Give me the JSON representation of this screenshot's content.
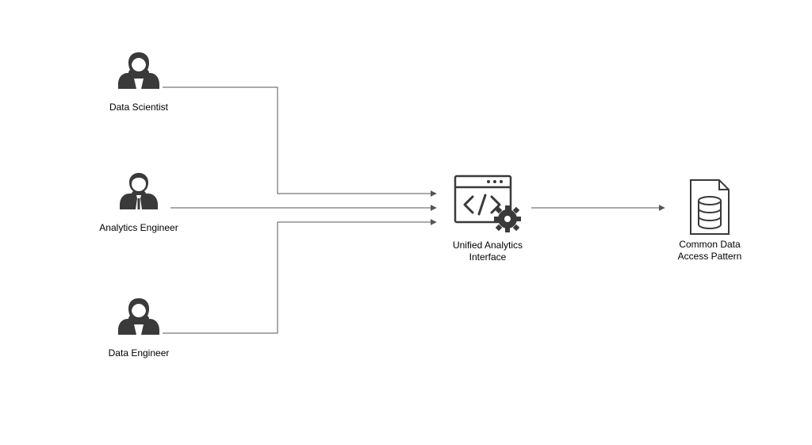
{
  "roles": {
    "data_scientist": "Data Scientist",
    "analytics_engineer": "Analytics Engineer",
    "data_engineer": "Data Engineer"
  },
  "center": {
    "label_line1": "Unified Analytics",
    "label_line2": "Interface"
  },
  "right": {
    "label_line1": "Common Data",
    "label_line2": "Access Pattern"
  }
}
